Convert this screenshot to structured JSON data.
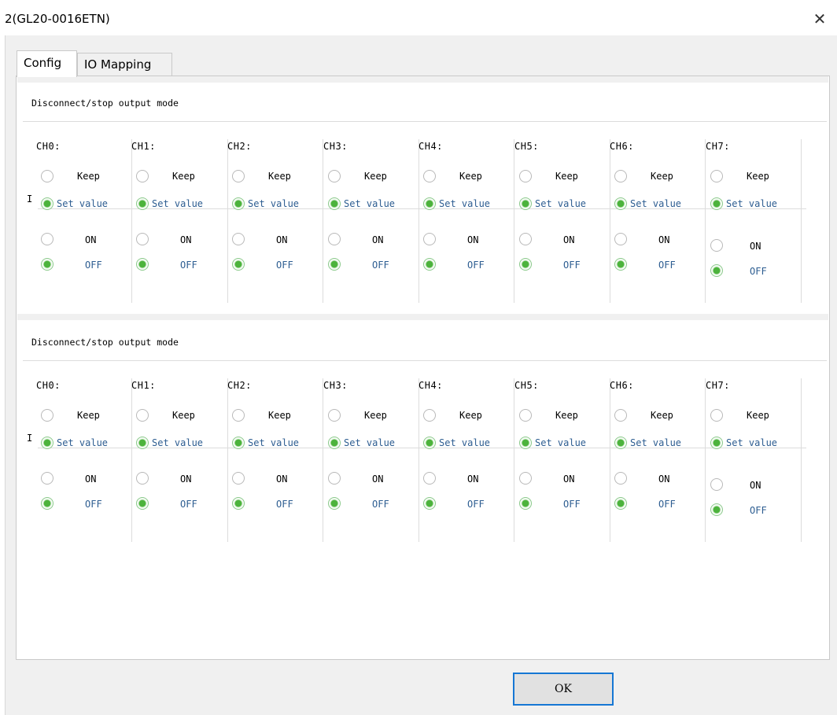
{
  "window": {
    "title": "2(GL20-0016ETN)",
    "close_icon": "close-icon"
  },
  "tabs": [
    {
      "label": "Config",
      "selected": true
    },
    {
      "label": "IO Mapping",
      "selected": false
    }
  ],
  "sections": [
    {
      "title": "Disconnect/stop output mode",
      "row_label": "I",
      "channels": [
        {
          "name": "CH0:",
          "mode": "Set value",
          "value": "OFF"
        },
        {
          "name": "CH1:",
          "mode": "Set value",
          "value": "OFF"
        },
        {
          "name": "CH2:",
          "mode": "Set value",
          "value": "OFF"
        },
        {
          "name": "CH3:",
          "mode": "Set value",
          "value": "OFF"
        },
        {
          "name": "CH4:",
          "mode": "Set value",
          "value": "OFF"
        },
        {
          "name": "CH5:",
          "mode": "Set value",
          "value": "OFF"
        },
        {
          "name": "CH6:",
          "mode": "Set value",
          "value": "OFF"
        },
        {
          "name": "CH7:",
          "mode": "Set value",
          "value": "OFF"
        }
      ]
    },
    {
      "title": "Disconnect/stop output mode",
      "row_label": "I",
      "channels": [
        {
          "name": "CH0:",
          "mode": "Set value",
          "value": "OFF"
        },
        {
          "name": "CH1:",
          "mode": "Set value",
          "value": "OFF"
        },
        {
          "name": "CH2:",
          "mode": "Set value",
          "value": "OFF"
        },
        {
          "name": "CH3:",
          "mode": "Set value",
          "value": "OFF"
        },
        {
          "name": "CH4:",
          "mode": "Set value",
          "value": "OFF"
        },
        {
          "name": "CH5:",
          "mode": "Set value",
          "value": "OFF"
        },
        {
          "name": "CH6:",
          "mode": "Set value",
          "value": "OFF"
        },
        {
          "name": "CH7:",
          "mode": "Set value",
          "value": "OFF"
        }
      ]
    }
  ],
  "options": {
    "keep": "Keep",
    "set_value": "Set value",
    "on": "ON",
    "off": "OFF"
  },
  "buttons": {
    "ok": "OK"
  },
  "colors": {
    "radio_selected": "#4cb33c",
    "value_text": "#2d5d91",
    "ok_border": "#1677d4"
  }
}
